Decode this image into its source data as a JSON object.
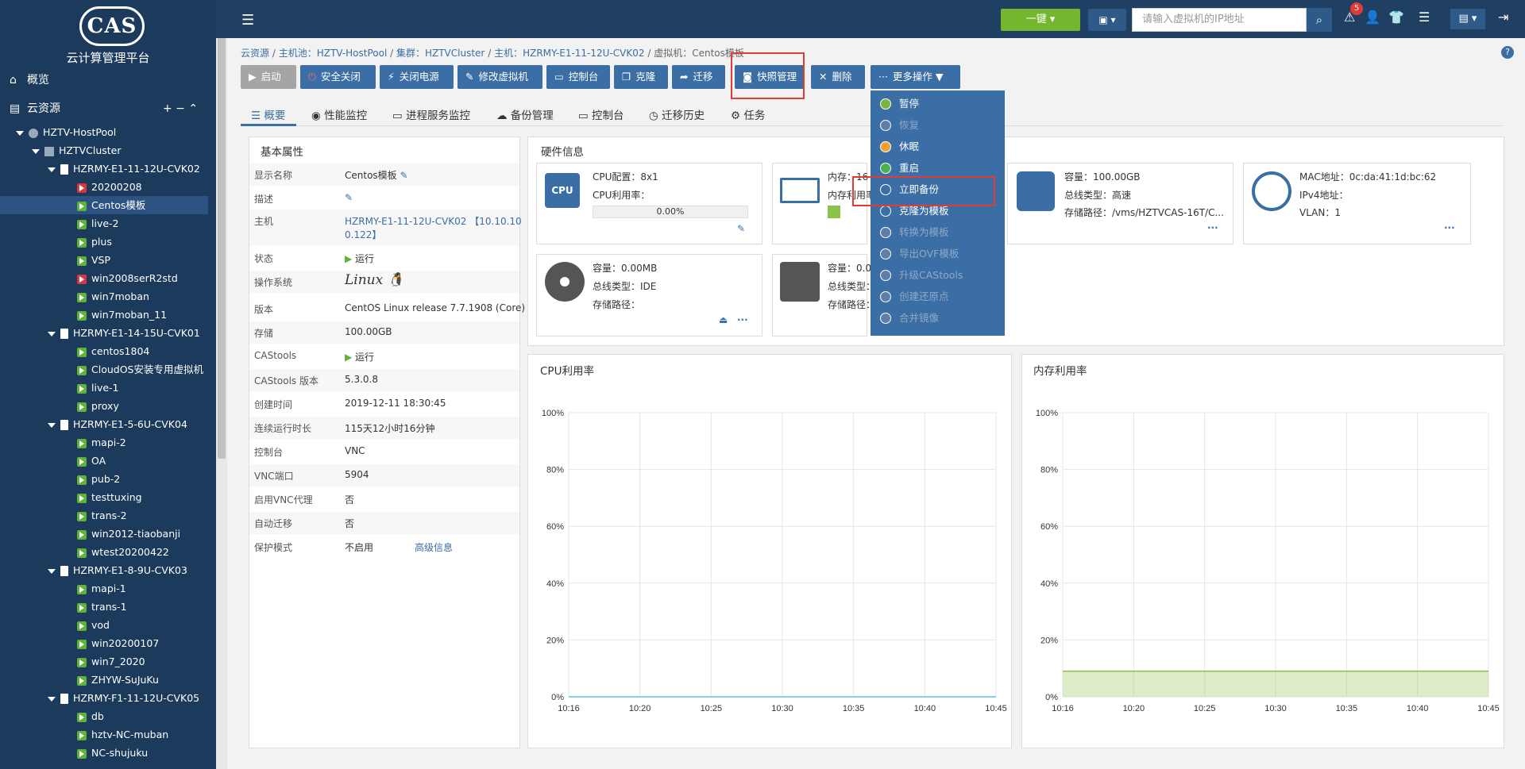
{
  "logo": {
    "mark": "CAS",
    "subtitle": "云计算管理平台"
  },
  "nav": {
    "overview": "概览",
    "cloud_resources": "云资源",
    "actions": "+  −  ⌃"
  },
  "tree": {
    "pool": "HZTV-HostPool",
    "cluster": "HZTVCluster",
    "rows": [
      {
        "type": "host",
        "label": "HZRMY-E1-11-12U-CVK02"
      },
      {
        "type": "vm-stop",
        "label": "20200208"
      },
      {
        "type": "vm-run",
        "label": "Centos模板",
        "selected": true
      },
      {
        "type": "vm-run",
        "label": "live-2"
      },
      {
        "type": "vm-run",
        "label": "plus"
      },
      {
        "type": "vm-run",
        "label": "VSP"
      },
      {
        "type": "vm-stop",
        "label": "win2008serR2std"
      },
      {
        "type": "vm-run",
        "label": "win7moban"
      },
      {
        "type": "vm-run",
        "label": "win7moban_11"
      },
      {
        "type": "host",
        "label": "HZRMY-E1-14-15U-CVK01"
      },
      {
        "type": "vm-run",
        "label": "centos1804"
      },
      {
        "type": "vm-run",
        "label": "CloudOS安装专用虚拟机"
      },
      {
        "type": "vm-run",
        "label": "live-1"
      },
      {
        "type": "vm-run",
        "label": "proxy"
      },
      {
        "type": "host",
        "label": "HZRMY-E1-5-6U-CVK04"
      },
      {
        "type": "vm-run",
        "label": "mapi-2"
      },
      {
        "type": "vm-run",
        "label": "OA"
      },
      {
        "type": "vm-run",
        "label": "pub-2"
      },
      {
        "type": "vm-run",
        "label": "testtuxing"
      },
      {
        "type": "vm-run",
        "label": "trans-2"
      },
      {
        "type": "vm-run",
        "label": "win2012-tiaobanji"
      },
      {
        "type": "vm-run",
        "label": "wtest20200422"
      },
      {
        "type": "host",
        "label": "HZRMY-E1-8-9U-CVK03"
      },
      {
        "type": "vm-run",
        "label": "mapi-1"
      },
      {
        "type": "vm-run",
        "label": "trans-1"
      },
      {
        "type": "vm-run",
        "label": "vod"
      },
      {
        "type": "vm-run",
        "label": "win20200107"
      },
      {
        "type": "vm-run",
        "label": "win7_2020"
      },
      {
        "type": "vm-run",
        "label": "ZHYW-SuJuKu"
      },
      {
        "type": "host",
        "label": "HZRMY-F1-11-12U-CVK05"
      },
      {
        "type": "vm-run",
        "label": "db"
      },
      {
        "type": "vm-run",
        "label": "hztv-NC-muban"
      },
      {
        "type": "vm-run",
        "label": "NC-shujuku"
      }
    ]
  },
  "topbar": {
    "onekey": "一键",
    "search_placeholder": "请输入虚拟机的IP地址",
    "alert_count": "5"
  },
  "breadcrumb": {
    "root": "云资源",
    "pool": "主机池：HZTV-HostPool",
    "cluster": "集群：HZTVCluster",
    "host": "主机：HZRMY-E1-11-12U-CVK02",
    "vm": "虚拟机：Centos模板",
    "sep": "/"
  },
  "toolbar": {
    "start": "启动",
    "shutdown": "安全关闭",
    "poweroff": "关闭电源",
    "modify": "修改虚拟机",
    "console": "控制台",
    "clone": "克隆",
    "migrate": "迁移",
    "snapshot": "快照管理",
    "delete": "删除",
    "more": "更多操作"
  },
  "tabs": [
    "概要",
    "性能监控",
    "进程服务监控",
    "备份管理",
    "控制台",
    "迁移历史",
    "任务"
  ],
  "basic": {
    "title": "基本属性",
    "rows": [
      {
        "k": "显示名称",
        "v": "Centos模板"
      },
      {
        "k": "描述",
        "v": ""
      },
      {
        "k": "主机",
        "v": "HZRMY-E1-11-12U-CVK02 【10.10.10",
        "v2": "0.122】"
      },
      {
        "k": "状态",
        "v": "运行"
      },
      {
        "k": "操作系统",
        "v": "Linux"
      },
      {
        "k": "版本",
        "v": "CentOS Linux release 7.7.1908 (Core)"
      },
      {
        "k": "存储",
        "v": "100.00GB"
      },
      {
        "k": "CAStools",
        "v": "运行"
      },
      {
        "k": "CAStools 版本",
        "v": "5.3.0.8"
      },
      {
        "k": "创建时间",
        "v": "2019-12-11 18:30:45"
      },
      {
        "k": "连续运行时长",
        "v": "115天12小时16分钟"
      },
      {
        "k": "控制台",
        "v": "VNC"
      },
      {
        "k": "VNC端口",
        "v": "5904"
      },
      {
        "k": "启用VNC代理",
        "v": "否"
      },
      {
        "k": "自动迁移",
        "v": "否"
      },
      {
        "k": "保护模式",
        "v": "不启用",
        "link": "高级信息"
      }
    ]
  },
  "hardware": {
    "title": "硬件信息",
    "cpu": {
      "label": "CPU",
      "config": "CPU配置：8x1",
      "usage_label": "CPU利用率：",
      "usage": "0.00%"
    },
    "mem": {
      "line1": "内存：16",
      "line2": "内存利用率"
    },
    "disk": {
      "capacity": "容量：100.00GB",
      "bus": "总线类型：高速",
      "path": "存储路径：/vms/HZTVCAS-16T/C..."
    },
    "net": {
      "mac": "MAC地址：0c:da:41:1d:bc:62",
      "ipv4": "IPv4地址：",
      "vlan": "VLAN：1"
    },
    "cdrom": {
      "capacity": "容量：0.00MB",
      "bus": "总线类型：IDE",
      "path": "存储路径："
    },
    "floppy": {
      "capacity": "容量：0.0",
      "bus": "总线类型：",
      "path": "存储路径："
    },
    "more": "···"
  },
  "dropdown": [
    {
      "label": "暂停",
      "enabled": true,
      "color": "#7cb342"
    },
    {
      "label": "恢复",
      "enabled": false,
      "color": "#5f7fa8"
    },
    {
      "label": "休眠",
      "enabled": true,
      "color": "#f0a030"
    },
    {
      "label": "重启",
      "enabled": true,
      "color": "#4caf50"
    },
    {
      "label": "立即备份",
      "enabled": true,
      "color": "#3a6ea5"
    },
    {
      "label": "克隆为模板",
      "enabled": true,
      "color": "#3a6ea5"
    },
    {
      "label": "转换为模板",
      "enabled": false,
      "color": "#5f7fa8"
    },
    {
      "label": "导出OVF模板",
      "enabled": false,
      "color": "#5f7fa8"
    },
    {
      "label": "升级CAStools",
      "enabled": false,
      "color": "#5f7fa8"
    },
    {
      "label": "创建还原点",
      "enabled": false,
      "color": "#5f7fa8"
    },
    {
      "label": "合并镜像",
      "enabled": false,
      "color": "#5f7fa8"
    }
  ],
  "charts": {
    "cpu_title": "CPU利用率",
    "mem_title": "内存利用率"
  },
  "chart_data": [
    {
      "type": "line",
      "title": "CPU利用率",
      "x": [
        "10:16",
        "10:20",
        "10:25",
        "10:30",
        "10:35",
        "10:40",
        "10:45"
      ],
      "yticks": [
        "100%",
        "80%",
        "60%",
        "40%",
        "20%",
        "0%"
      ],
      "ylim": [
        0,
        100
      ],
      "series": [
        {
          "values": [
            0,
            0,
            0,
            0,
            0,
            0,
            0
          ],
          "color": "#5bc0de"
        }
      ]
    },
    {
      "type": "area",
      "title": "内存利用率",
      "x": [
        "10:16",
        "10:20",
        "10:25",
        "10:30",
        "10:35",
        "10:40",
        "10:45"
      ],
      "yticks": [
        "100%",
        "80%",
        "60%",
        "40%",
        "20%",
        "0%"
      ],
      "ylim": [
        0,
        100
      ],
      "series": [
        {
          "values": [
            9,
            9,
            9,
            9,
            9,
            9,
            9
          ],
          "color": "#8bc34a"
        }
      ]
    }
  ]
}
